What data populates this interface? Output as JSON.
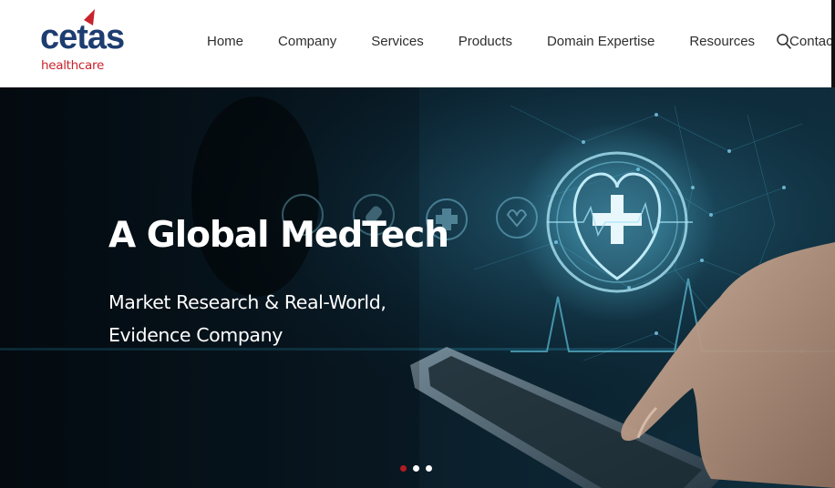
{
  "brand": {
    "name": "cetas",
    "sub": "healthcare",
    "colors": {
      "primary": "#1d3d70",
      "accent": "#c8232c"
    }
  },
  "nav": {
    "items": [
      {
        "label": "Home"
      },
      {
        "label": "Company"
      },
      {
        "label": "Services"
      },
      {
        "label": "Products"
      },
      {
        "label": "Domain Expertise"
      },
      {
        "label": "Resources"
      },
      {
        "label": "Contact us"
      }
    ],
    "search_icon": "search-icon"
  },
  "hero": {
    "title": "A Global MedTech",
    "subtitle": "Market Research & Real-World, Evidence Company",
    "slides": {
      "count": 3,
      "active": 1
    },
    "colors": {
      "background": "#081722",
      "glow": "#3fd0ff",
      "active_dot": "#b31b23"
    }
  }
}
